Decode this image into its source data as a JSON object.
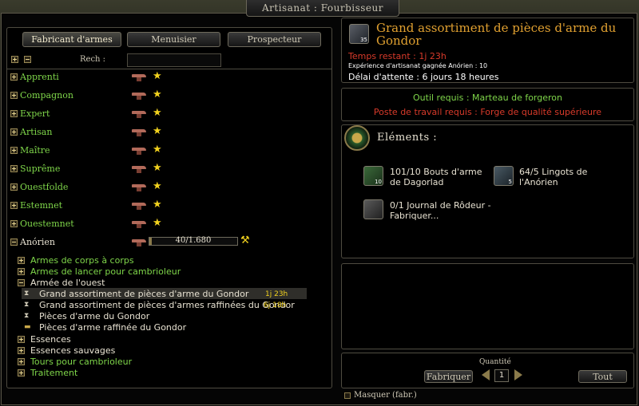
{
  "window": {
    "title": "Artisanat : Fourbisseur"
  },
  "tabs": [
    "Fabricant d'armes",
    "Menuisier",
    "Prospecteur"
  ],
  "search": {
    "label": "Rech :",
    "value": ""
  },
  "tiers": [
    "Apprenti",
    "Compagnon",
    "Expert",
    "Artisan",
    "Maître",
    "Suprême",
    "Ouestfolde",
    "Estemnet",
    "Ouestemnet",
    "Anórien"
  ],
  "anorien": {
    "progress_text": "40/1.680",
    "progress": 40,
    "progress_max": 1680
  },
  "categories": [
    "Armes de corps à corps",
    "Armes de lancer pour cambrioleur",
    "Armée de l'ouest",
    "Essences",
    "Essences sauvages",
    "Tours pour cambrioleur",
    "Traitement"
  ],
  "recipes": [
    {
      "name": "Grand assortiment de pièces d'arme du Gondor",
      "timer": "1j 23h"
    },
    {
      "name": "Grand assortiment de pièces d'armes raffinées du Gondor",
      "timer": "6j 18h"
    },
    {
      "name": "Pièces d'arme du Gondor"
    },
    {
      "name": "Pièces d'arme raffinée du Gondor"
    }
  ],
  "detail": {
    "title": "Grand assortiment de pièces d'arme du Gondor",
    "icon_qty": "35",
    "time_remaining": "Temps restant : 1j 23h",
    "xp": "Expérience d'artisanat gagnée Anórien : 10",
    "cooldown": "Délai d'attente : 6 jours 18 heures"
  },
  "requirements": {
    "tool": "Outil requis : Marteau de forgeron",
    "station": "Poste de travail requis : Forge de qualité supérieure"
  },
  "ingredients": {
    "heading": "Eléments :",
    "items": [
      {
        "text": "101/10 Bouts d'arme de Dagorlad",
        "qty": "10"
      },
      {
        "text": "64/5 Lingots de l'Anórien",
        "qty": "5"
      },
      {
        "text": "0/1 Journal de Rôdeur - Fabriquer..."
      }
    ]
  },
  "craft": {
    "quantity_label": "Quantité",
    "craft_label": "Fabriquer",
    "quantity": "1",
    "all_label": "Tout"
  },
  "footer": {
    "hide_label": "Masquer (fabr.)"
  },
  "colors": {
    "tier_green": "#7fd64a",
    "title_orange": "#e0a030",
    "warning_red": "#d83a2a",
    "timer_yellow": "#f2d21e"
  }
}
